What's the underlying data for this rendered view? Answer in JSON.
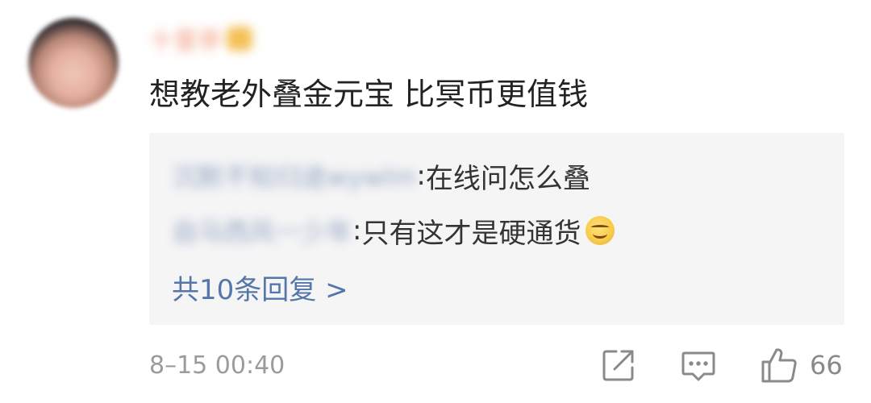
{
  "comment": {
    "username": "十里亭",
    "text": "想教老外叠金元宝 比冥币更值钱",
    "timestamp": "8–15 00:40",
    "like_count": "66"
  },
  "replies": [
    {
      "author": "沉默不知归途wywlm",
      "separator": ":",
      "content": "在线问怎么叠"
    },
    {
      "author": "自马西风一少年",
      "separator": ":",
      "content": "只有这才是硬通货",
      "emoji": "smile-emoji"
    }
  ],
  "more_replies_label": "共10条回复 >",
  "icons": {
    "share": "share-icon",
    "comment": "comment-icon",
    "like": "thumbs-up-icon"
  },
  "colors": {
    "link": "#5476a8",
    "reply_bg": "#f5f5f6",
    "text": "#222222",
    "muted": "#9b9b9b"
  }
}
